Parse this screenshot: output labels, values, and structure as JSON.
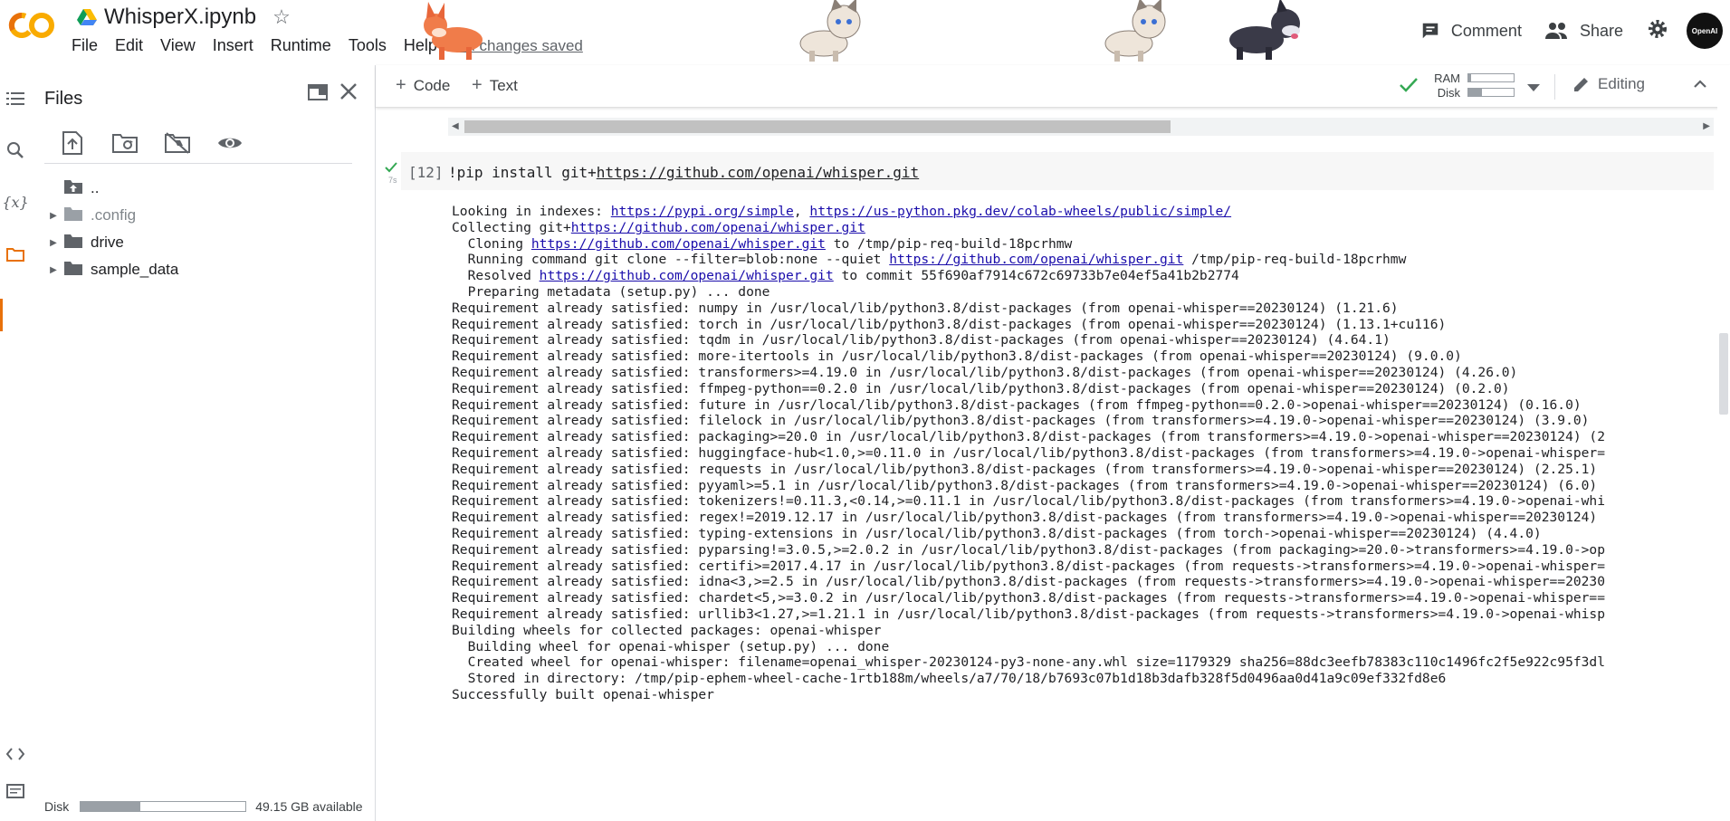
{
  "header": {
    "notebook_title": "WhisperX.ipynb",
    "menu": [
      "File",
      "Edit",
      "View",
      "Insert",
      "Runtime",
      "Tools",
      "Help"
    ],
    "save_status": "All changes saved",
    "comment_label": "Comment",
    "share_label": "Share",
    "avatar_text": "OpenAI"
  },
  "files_panel": {
    "title": "Files",
    "tree": [
      {
        "name": "..",
        "expandable": false
      },
      {
        "name": ".config",
        "expandable": true
      },
      {
        "name": "drive",
        "expandable": true
      },
      {
        "name": "sample_data",
        "expandable": true
      }
    ],
    "disk_label": "Disk",
    "disk_available": "49.15 GB available",
    "disk_used_fraction": 0.36
  },
  "toolbar": {
    "add_code": "Code",
    "add_text": "Text",
    "ram_label": "RAM",
    "disk_label": "Disk",
    "ram_fraction": 0.05,
    "disk_fraction": 0.3,
    "editing_label": "Editing"
  },
  "cell": {
    "exec_count": "[12]",
    "run_time": "7s",
    "code_prefix": "!pip install git+",
    "code_link": "https://github.com/openai/whisper.git"
  },
  "output_lines": [
    {
      "text": "Looking in indexes: ",
      "links": [
        "https://pypi.org/simple",
        ", ",
        "https://us-python.pkg.dev/colab-wheels/public/simple/"
      ]
    },
    {
      "text": "Collecting git+",
      "links": [
        "https://github.com/openai/whisper.git"
      ]
    },
    {
      "text": "  Cloning ",
      "links": [
        "https://github.com/openai/whisper.git",
        " to /tmp/pip-req-build-18pcrhmw"
      ]
    },
    {
      "text": "  Running command git clone --filter=blob:none --quiet ",
      "links": [
        "https://github.com/openai/whisper.git",
        " /tmp/pip-req-build-18pcrhmw"
      ]
    },
    {
      "text": "  Resolved ",
      "links": [
        "https://github.com/openai/whisper.git",
        " to commit 55f690af7914c672c69733b7e04ef5a41b2b2774"
      ]
    },
    {
      "text": "  Preparing metadata (setup.py) ... done"
    },
    {
      "text": "Requirement already satisfied: numpy in /usr/local/lib/python3.8/dist-packages (from openai-whisper==20230124) (1.21.6)"
    },
    {
      "text": "Requirement already satisfied: torch in /usr/local/lib/python3.8/dist-packages (from openai-whisper==20230124) (1.13.1+cu116)"
    },
    {
      "text": "Requirement already satisfied: tqdm in /usr/local/lib/python3.8/dist-packages (from openai-whisper==20230124) (4.64.1)"
    },
    {
      "text": "Requirement already satisfied: more-itertools in /usr/local/lib/python3.8/dist-packages (from openai-whisper==20230124) (9.0.0)"
    },
    {
      "text": "Requirement already satisfied: transformers>=4.19.0 in /usr/local/lib/python3.8/dist-packages (from openai-whisper==20230124) (4.26.0)"
    },
    {
      "text": "Requirement already satisfied: ffmpeg-python==0.2.0 in /usr/local/lib/python3.8/dist-packages (from openai-whisper==20230124) (0.2.0)"
    },
    {
      "text": "Requirement already satisfied: future in /usr/local/lib/python3.8/dist-packages (from ffmpeg-python==0.2.0->openai-whisper==20230124) (0.16.0)"
    },
    {
      "text": "Requirement already satisfied: filelock in /usr/local/lib/python3.8/dist-packages (from transformers>=4.19.0->openai-whisper==20230124) (3.9.0)"
    },
    {
      "text": "Requirement already satisfied: packaging>=20.0 in /usr/local/lib/python3.8/dist-packages (from transformers>=4.19.0->openai-whisper==20230124) (2"
    },
    {
      "text": "Requirement already satisfied: huggingface-hub<1.0,>=0.11.0 in /usr/local/lib/python3.8/dist-packages (from transformers>=4.19.0->openai-whisper="
    },
    {
      "text": "Requirement already satisfied: requests in /usr/local/lib/python3.8/dist-packages (from transformers>=4.19.0->openai-whisper==20230124) (2.25.1)"
    },
    {
      "text": "Requirement already satisfied: pyyaml>=5.1 in /usr/local/lib/python3.8/dist-packages (from transformers>=4.19.0->openai-whisper==20230124) (6.0)"
    },
    {
      "text": "Requirement already satisfied: tokenizers!=0.11.3,<0.14,>=0.11.1 in /usr/local/lib/python3.8/dist-packages (from transformers>=4.19.0->openai-whi"
    },
    {
      "text": "Requirement already satisfied: regex!=2019.12.17 in /usr/local/lib/python3.8/dist-packages (from transformers>=4.19.0->openai-whisper==20230124)"
    },
    {
      "text": "Requirement already satisfied: typing-extensions in /usr/local/lib/python3.8/dist-packages (from torch->openai-whisper==20230124) (4.4.0)"
    },
    {
      "text": "Requirement already satisfied: pyparsing!=3.0.5,>=2.0.2 in /usr/local/lib/python3.8/dist-packages (from packaging>=20.0->transformers>=4.19.0->op"
    },
    {
      "text": "Requirement already satisfied: certifi>=2017.4.17 in /usr/local/lib/python3.8/dist-packages (from requests->transformers>=4.19.0->openai-whisper="
    },
    {
      "text": "Requirement already satisfied: idna<3,>=2.5 in /usr/local/lib/python3.8/dist-packages (from requests->transformers>=4.19.0->openai-whisper==20230"
    },
    {
      "text": "Requirement already satisfied: chardet<5,>=3.0.2 in /usr/local/lib/python3.8/dist-packages (from requests->transformers>=4.19.0->openai-whisper=="
    },
    {
      "text": "Requirement already satisfied: urllib3<1.27,>=1.21.1 in /usr/local/lib/python3.8/dist-packages (from requests->transformers>=4.19.0->openai-whisp"
    },
    {
      "text": "Building wheels for collected packages: openai-whisper"
    },
    {
      "text": "  Building wheel for openai-whisper (setup.py) ... done"
    },
    {
      "text": "  Created wheel for openai-whisper: filename=openai_whisper-20230124-py3-none-any.whl size=1179329 sha256=88dc3eefb78383c110c1496fc2f5e922c95f3dl"
    },
    {
      "text": "  Stored in directory: /tmp/pip-ephem-wheel-cache-1rtb188m/wheels/a7/70/18/b7693c07b1d18b3dafb328f5d0496aa0d41a9c09ef332fd8e6"
    },
    {
      "text": "Successfully built openai-whisper"
    }
  ],
  "colors": {
    "accent_orange": "#e8710a",
    "logo_yellow": "#f9ab00",
    "check_green": "#34a853",
    "link_blue": "#1a0dab"
  },
  "icons": {
    "rail": [
      "toc-icon",
      "search-icon",
      "variables-icon",
      "files-icon",
      "code-snippets-icon",
      "terminal-icon"
    ],
    "files_toolbar": [
      "upload-icon",
      "refresh-folder-icon",
      "drive-off-icon",
      "visibility-icon"
    ]
  }
}
